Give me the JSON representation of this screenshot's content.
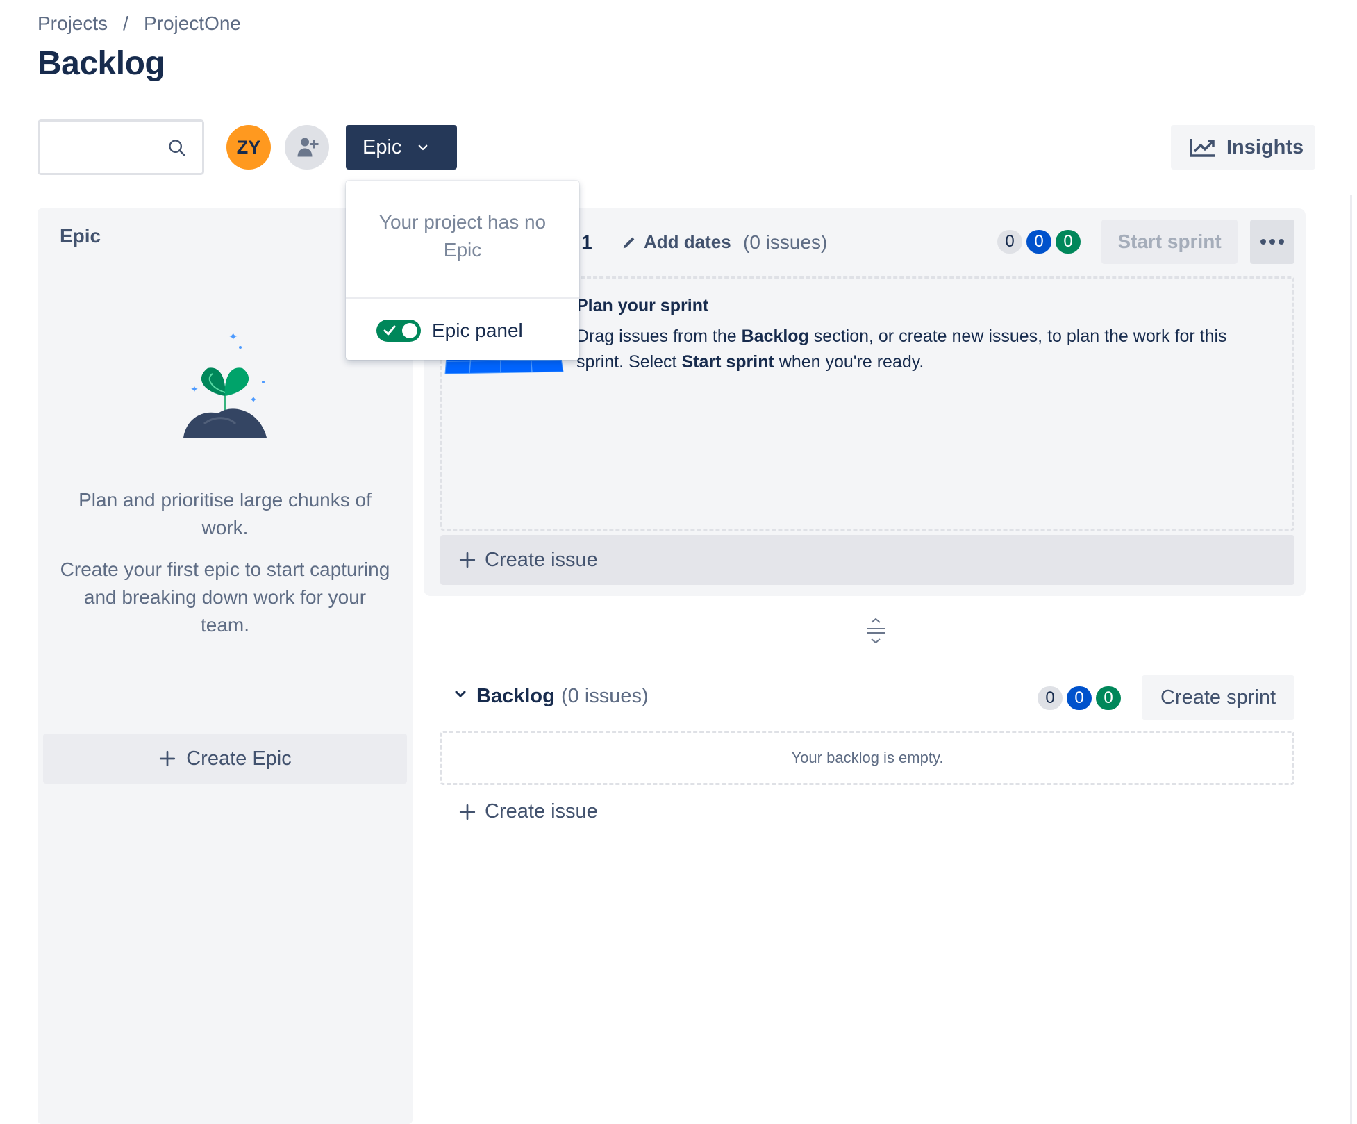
{
  "breadcrumb": {
    "projects": "Projects",
    "separator": "/",
    "project": "ProjectOne"
  },
  "page": {
    "title": "Backlog"
  },
  "toolbar": {
    "search": {
      "value": "",
      "placeholder": ""
    },
    "avatar_initials": "ZY",
    "epic_filter_label": "Epic",
    "insights_label": "Insights"
  },
  "epic_dropdown": {
    "empty_text": "Your project has no Epic",
    "toggle_label": "Epic panel",
    "toggle_on": true
  },
  "epic_panel": {
    "title": "Epic",
    "description_1": "Plan and prioritise large chunks of work.",
    "description_2": "Create your first epic to start capturing and breaking down work for your team.",
    "create_label": "Create Epic"
  },
  "sprint": {
    "name_visible": "t 1",
    "add_dates_label": "Add dates",
    "issue_count": "(0 issues)",
    "badges": [
      "0",
      "0",
      "0"
    ],
    "start_label": "Start sprint",
    "plan_title": "Plan your sprint",
    "plan_text_1": "Drag issues from the ",
    "plan_text_bold_1": "Backlog",
    "plan_text_2": " section, or create new issues, to plan the work for this sprint. Select ",
    "plan_text_bold_2": "Start sprint",
    "plan_text_3": " when you're ready.",
    "create_issue_label": "Create issue"
  },
  "backlog": {
    "title": "Backlog",
    "issue_count": "(0 issues)",
    "badges": [
      "0",
      "0",
      "0"
    ],
    "create_sprint_label": "Create sprint",
    "empty_text": "Your backlog is empty.",
    "create_issue_label": "Create issue"
  },
  "colors": {
    "primary_dark": "#253858",
    "avatar_orange": "#ff991f",
    "badge_blue": "#0052cc",
    "badge_green": "#00875a",
    "panel_bg": "#f4f5f7"
  },
  "icons": [
    "search-icon",
    "add-person-icon",
    "chevron-down-icon",
    "chart-line-icon",
    "pencil-icon",
    "more-icon",
    "plus-icon",
    "drag-handle-icon",
    "check-icon"
  ]
}
